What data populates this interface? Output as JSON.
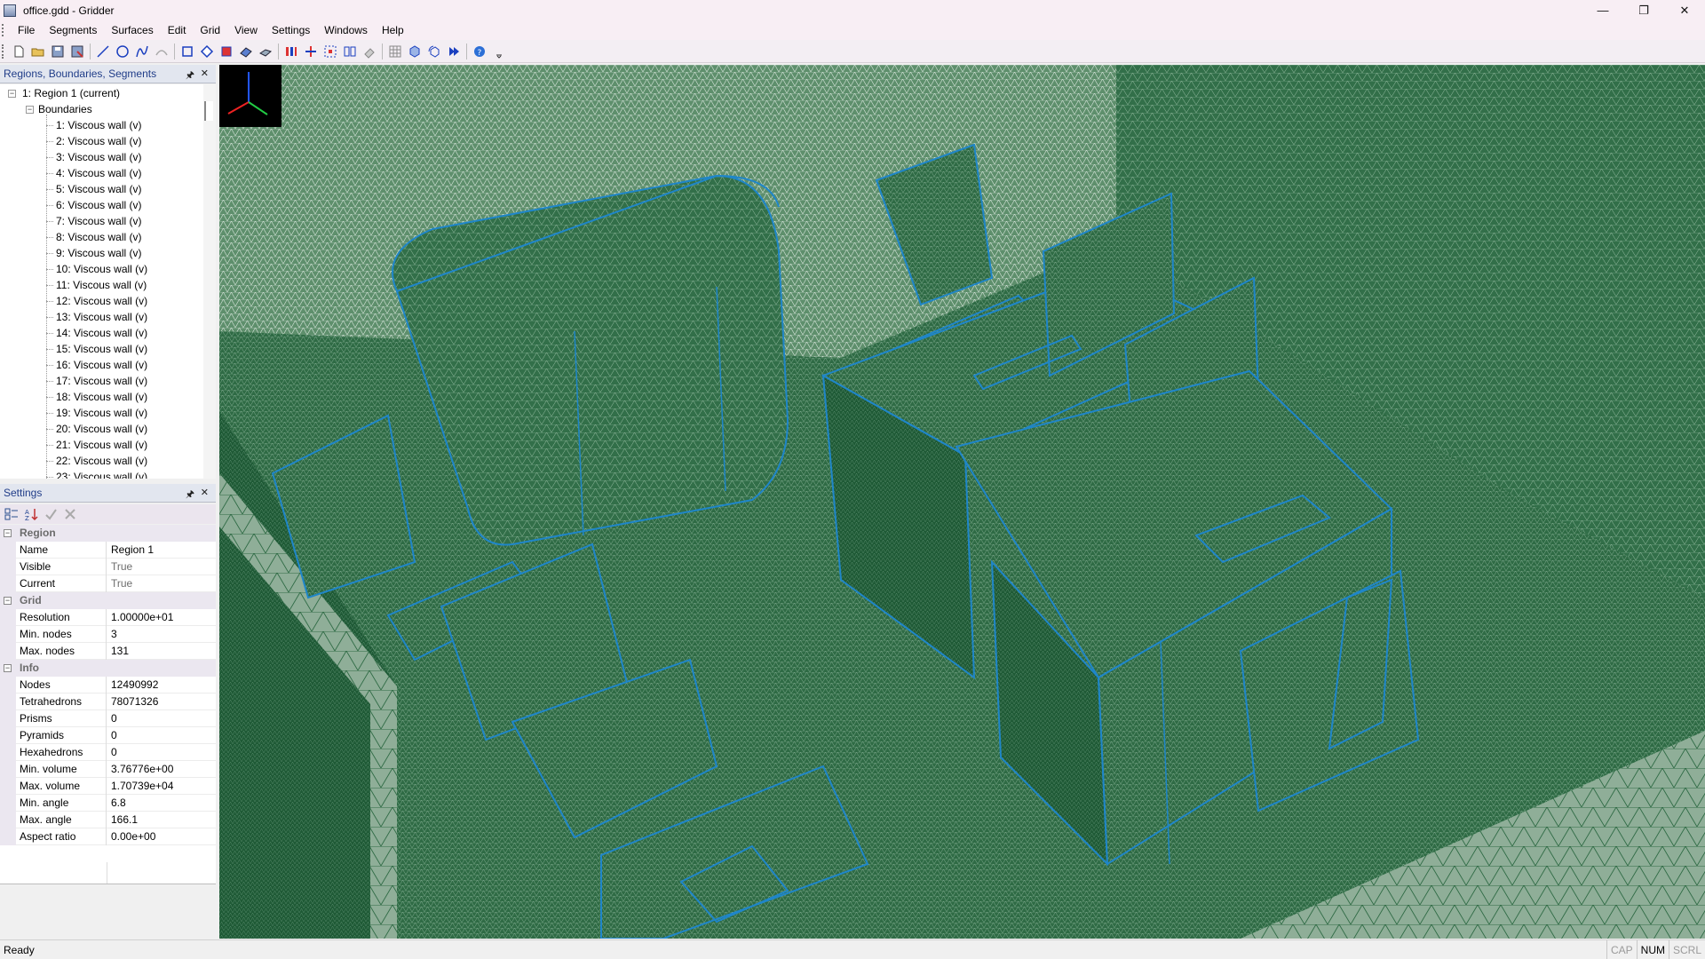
{
  "window": {
    "title": "office.gdd - Gridder"
  },
  "menu": [
    "File",
    "Segments",
    "Surfaces",
    "Edit",
    "Grid",
    "View",
    "Settings",
    "Windows",
    "Help"
  ],
  "toolbar_icons": [
    "new-file-icon",
    "open-folder-icon",
    "save-icon",
    "save-as-icon",
    "sep",
    "draw-line-icon",
    "draw-circle-icon",
    "draw-spline-icon",
    "draw-arc-icon",
    "sep",
    "new-region-icon",
    "diamond-icon",
    "box-red-icon",
    "surface-a-icon",
    "surface-b-icon",
    "sep",
    "red-bars-icon",
    "cross-move-icon",
    "box-select-icon",
    "split-icon",
    "erase-icon",
    "sep",
    "grid-dots-icon",
    "cube-icon",
    "cube-rotate-icon",
    "play-icon",
    "sep",
    "help-icon"
  ],
  "tree": {
    "title": "Regions, Boundaries, Segments",
    "region": "1: Region 1 (current)",
    "boundaries_label": "Boundaries",
    "items": [
      "1: Viscous wall (v)",
      "2: Viscous wall (v)",
      "3: Viscous wall (v)",
      "4: Viscous wall (v)",
      "5: Viscous wall (v)",
      "6: Viscous wall (v)",
      "7: Viscous wall (v)",
      "8: Viscous wall (v)",
      "9: Viscous wall (v)",
      "10: Viscous wall (v)",
      "11: Viscous wall (v)",
      "12: Viscous wall (v)",
      "13: Viscous wall (v)",
      "14: Viscous wall (v)",
      "15: Viscous wall (v)",
      "16: Viscous wall (v)",
      "17: Viscous wall (v)",
      "18: Viscous wall (v)",
      "19: Viscous wall (v)",
      "20: Viscous wall (v)",
      "21: Viscous wall (v)",
      "22: Viscous wall (v)",
      "23: Viscous wall (v)"
    ]
  },
  "settings": {
    "title": "Settings",
    "categories": [
      {
        "label": "Region",
        "rows": [
          {
            "name": "Name",
            "value": "Region 1",
            "dim": false
          },
          {
            "name": "Visible",
            "value": "True",
            "dim": true
          },
          {
            "name": "Current",
            "value": "True",
            "dim": true
          }
        ]
      },
      {
        "label": "Grid",
        "rows": [
          {
            "name": "Resolution",
            "value": "1.00000e+01",
            "dim": false
          },
          {
            "name": "Min. nodes",
            "value": "3",
            "dim": false
          },
          {
            "name": "Max. nodes",
            "value": "131",
            "dim": false
          }
        ]
      },
      {
        "label": "Info",
        "rows": [
          {
            "name": "Nodes",
            "value": "12490992",
            "dim": false
          },
          {
            "name": "Tetrahedrons",
            "value": "78071326",
            "dim": false
          },
          {
            "name": "Prisms",
            "value": "0",
            "dim": false
          },
          {
            "name": "Pyramids",
            "value": "0",
            "dim": false
          },
          {
            "name": "Hexahedrons",
            "value": "0",
            "dim": false
          },
          {
            "name": "Min. volume",
            "value": "3.76776e+00",
            "dim": false
          },
          {
            "name": "Max. volume",
            "value": "1.70739e+04",
            "dim": false
          },
          {
            "name": "Min. angle",
            "value": "6.8",
            "dim": false
          },
          {
            "name": "Max. angle",
            "value": "166.1",
            "dim": false
          },
          {
            "name": "Aspect ratio",
            "value": "0.00e+00",
            "dim": false
          }
        ]
      }
    ]
  },
  "status": {
    "text": "Ready",
    "indicators": [
      {
        "label": "CAP",
        "active": false
      },
      {
        "label": "NUM",
        "active": true
      },
      {
        "label": "SCRL",
        "active": false
      }
    ]
  },
  "colors": {
    "mesh_fill": "#2f6b45",
    "mesh_edge": "#1f86c9",
    "panel_header": "#e2e6ef"
  }
}
